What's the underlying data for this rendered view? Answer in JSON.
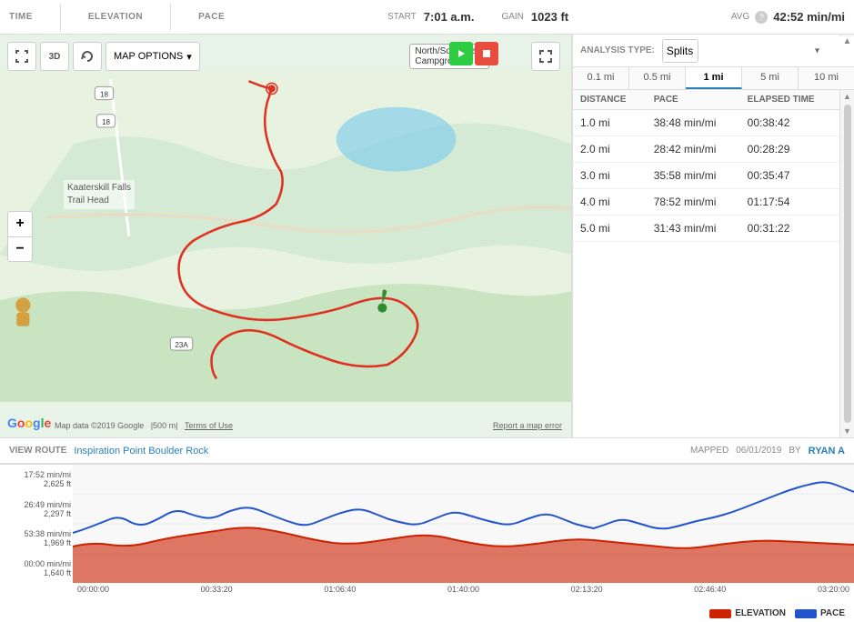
{
  "header": {
    "time_label": "TIME",
    "elevation_label": "ELEVATION",
    "pace_label": "PACE",
    "start_label": "START",
    "start_value": "7:01 a.m.",
    "gain_label": "GAIN",
    "gain_value": "1023 ft",
    "avg_label": "AVG",
    "avg_value": "42:52 min/mi",
    "info_icon": "?"
  },
  "map": {
    "campground_label": "North/South La...\nCampground",
    "trail_label": "Kaaterskill Falls\nTrail Head",
    "road_label_1": "18",
    "road_label_2": "23A",
    "attribution": "Map data ©2019 Google",
    "scale": "500 m",
    "terms": "Terms of Use",
    "report": "Report a map error"
  },
  "toolbar": {
    "map_options_label": "MAP OPTIONS",
    "expand_icon": "⤢",
    "zoom_in": "+",
    "zoom_out": "−"
  },
  "route_footer": {
    "view_route_label": "VIEW ROUTE",
    "route_name": "Inspiration Point Boulder Rock",
    "mapped_label": "MAPPED",
    "mapped_date": "06/01/2019",
    "by_label": "BY",
    "user": "RYAN A"
  },
  "splits": {
    "analysis_type_label": "ANALYSIS TYPE:",
    "analysis_type_value": "Splits",
    "distance_tabs": [
      {
        "label": "0.1 mi",
        "active": false
      },
      {
        "label": "0.5 mi",
        "active": false
      },
      {
        "label": "1 mi",
        "active": true
      },
      {
        "label": "5 mi",
        "active": false
      },
      {
        "label": "10 mi",
        "active": false
      }
    ],
    "table_headers": {
      "distance": "DISTANCE",
      "pace": "PACE",
      "elapsed_time": "ELAPSED TIME"
    },
    "rows": [
      {
        "distance": "1.0 mi",
        "pace": "38:48 min/mi",
        "elapsed_time": "00:38:42"
      },
      {
        "distance": "2.0 mi",
        "pace": "28:42 min/mi",
        "elapsed_time": "00:28:29"
      },
      {
        "distance": "3.0 mi",
        "pace": "35:58 min/mi",
        "elapsed_time": "00:35:47"
      },
      {
        "distance": "4.0 mi",
        "pace": "78:52 min/mi",
        "elapsed_time": "01:17:54"
      },
      {
        "distance": "5.0 mi",
        "pace": "31:43 min/mi",
        "elapsed_time": "00:31:22"
      }
    ]
  },
  "chart": {
    "y_labels": [
      "17:52 min/mi",
      "26:49 min/mi",
      "53:38 min/mi",
      "00:00 min/mi"
    ],
    "y_labels_right": [
      "2,625 ft",
      "2,297 ft",
      "1,969 ft",
      "1,640 ft"
    ],
    "x_labels": [
      "00:00:00",
      "00:33:20",
      "01:06:40",
      "01:40:00",
      "02:13:20",
      "02:46:40",
      "03:20:00"
    ],
    "legend": [
      {
        "label": "ELEVATION",
        "color": "#cc2200"
      },
      {
        "label": "PACE",
        "color": "#2255cc"
      }
    ]
  }
}
